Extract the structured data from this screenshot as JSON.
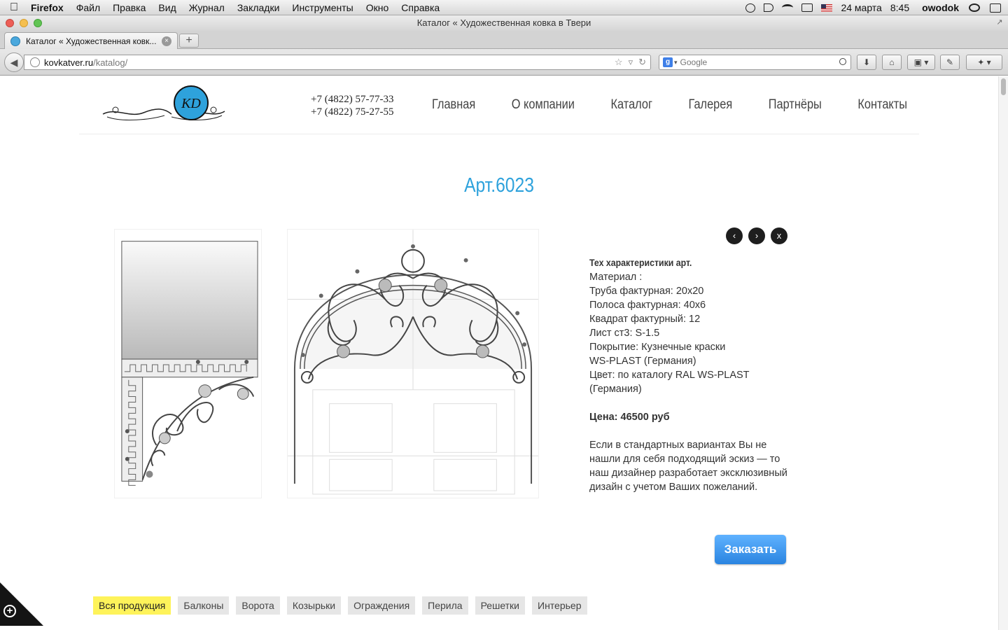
{
  "menubar": {
    "app": "Firefox",
    "items": [
      "Файл",
      "Правка",
      "Вид",
      "Журнал",
      "Закладки",
      "Инструменты",
      "Окно",
      "Справка"
    ],
    "date": "24 марта",
    "time": "8:45",
    "user": "owodok"
  },
  "window": {
    "title": "Каталог « Художественная ковка в Твери"
  },
  "tab": {
    "title": "Каталог « Художественная ковк..."
  },
  "toolbar": {
    "url_host": "kovkatver.ru",
    "url_path": "/katalog/",
    "search_placeholder": "Google",
    "search_engine_icon": "google-icon"
  },
  "site": {
    "phones": [
      "+7 (4822) 57-77-33",
      "+7 (4822) 75-27-55"
    ],
    "nav": [
      "Главная",
      "О компании",
      "Каталог",
      "Галерея",
      "Партнёры",
      "Контакты"
    ],
    "logo_text": "KD"
  },
  "product": {
    "title": "Арт.6023",
    "spec_title": "Тех характеристики арт.",
    "spec_lines": [
      "Материал :",
      "Труба фактурная: 20х20",
      "Полоса фактурная: 40х6",
      "Квадрат фактурный: 12",
      "Лист ст3: S-1.5",
      "Покрытие: Кузнечные краски",
      "WS-PLAST (Германия)",
      "Цвет: по каталогу RAL WS-PLAST",
      "(Германия)"
    ],
    "price": "Цена: 46500 руб",
    "note": "Если в стандартных вариантах Вы не нашли для себя подходящий эскиз — то наш дизайнер разработает эксклюзивный дизайн с учетом Ваших пожеланий.",
    "order_label": "Заказать",
    "nav_prev": "‹",
    "nav_next": "›",
    "nav_close": "x"
  },
  "categories": [
    "Вся продукция",
    "Балконы",
    "Ворота",
    "Козырьки",
    "Ограждения",
    "Перила",
    "Решетки",
    "Интерьер"
  ],
  "colors": {
    "accent": "#2ea2dc",
    "active_category": "#fef35a",
    "order_button": "#3a90ea"
  }
}
